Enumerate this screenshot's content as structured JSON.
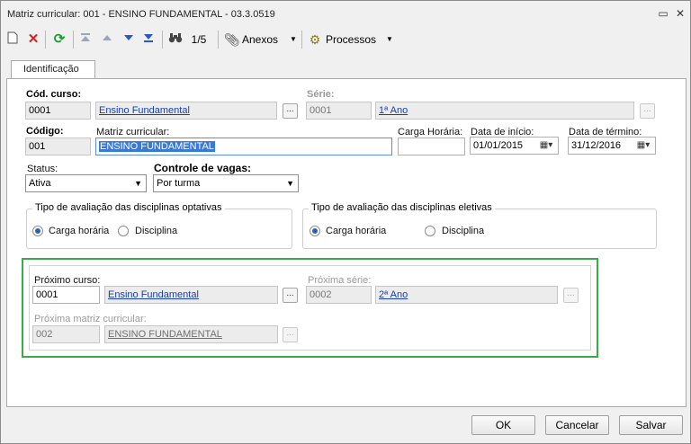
{
  "window": {
    "title": "Matriz curricular: 001 - ENSINO FUNDAMENTAL - 03.3.0519",
    "minimize_glyph": "▭",
    "close_glyph": "✕"
  },
  "toolbar": {
    "record_position": "1/5",
    "anexos_label": "Anexos",
    "processos_label": "Processos",
    "icons": [
      "new-icon",
      "delete-icon",
      "refresh-icon",
      "first-record-icon",
      "previous-record-icon",
      "next-record-icon",
      "last-record-icon",
      "binoculars-icon",
      "paperclip-icon",
      "gears-icon"
    ]
  },
  "tabs": [
    {
      "label": "Identificação",
      "active": true
    }
  ],
  "form": {
    "cod_curso": {
      "label": "Cód. curso:",
      "value": "0001",
      "name": "Ensino Fundamental"
    },
    "serie": {
      "label": "Série:",
      "value": "0001",
      "name": "1ª Ano"
    },
    "codigo": {
      "label": "Código:",
      "value": "001"
    },
    "matriz": {
      "label": "Matriz curricular:",
      "value": "ENSINO FUNDAMENTAL"
    },
    "carga_horaria": {
      "label": "Carga Horária:",
      "value": ""
    },
    "data_inicio": {
      "label": "Data de início:",
      "value": "01/01/2015"
    },
    "data_termino": {
      "label": "Data de término:",
      "value": "31/12/2016"
    },
    "status": {
      "label": "Status:",
      "value": "Ativa"
    },
    "controle_vagas": {
      "label": "Controle de vagas:",
      "value": "Por turma"
    },
    "avaliacao_optativas": {
      "title": "Tipo de avaliação das disciplinas optativas",
      "options": [
        "Carga horária",
        "Disciplina"
      ],
      "selected": "Carga horária"
    },
    "avaliacao_eletivas": {
      "title": "Tipo de avaliação das disciplinas eletivas",
      "options": [
        "Carga horária",
        "Disciplina"
      ],
      "selected": "Carga horária"
    },
    "proximo_curso": {
      "label": "Próximo curso:",
      "value": "0001",
      "name": "Ensino Fundamental"
    },
    "proxima_serie": {
      "label": "Próxima série:",
      "value": "0002",
      "name": "2ª Ano"
    },
    "proxima_matriz": {
      "label": "Próxima matriz curricular:",
      "value": "002",
      "name": "ENSINO FUNDAMENTAL"
    }
  },
  "buttons": {
    "ok": "OK",
    "cancel": "Cancelar",
    "save": "Salvar",
    "lookup": "..."
  },
  "colors": {
    "highlight_border": "#3bab4a",
    "link": "#1a3fa8",
    "selection": "#3b79d8"
  }
}
